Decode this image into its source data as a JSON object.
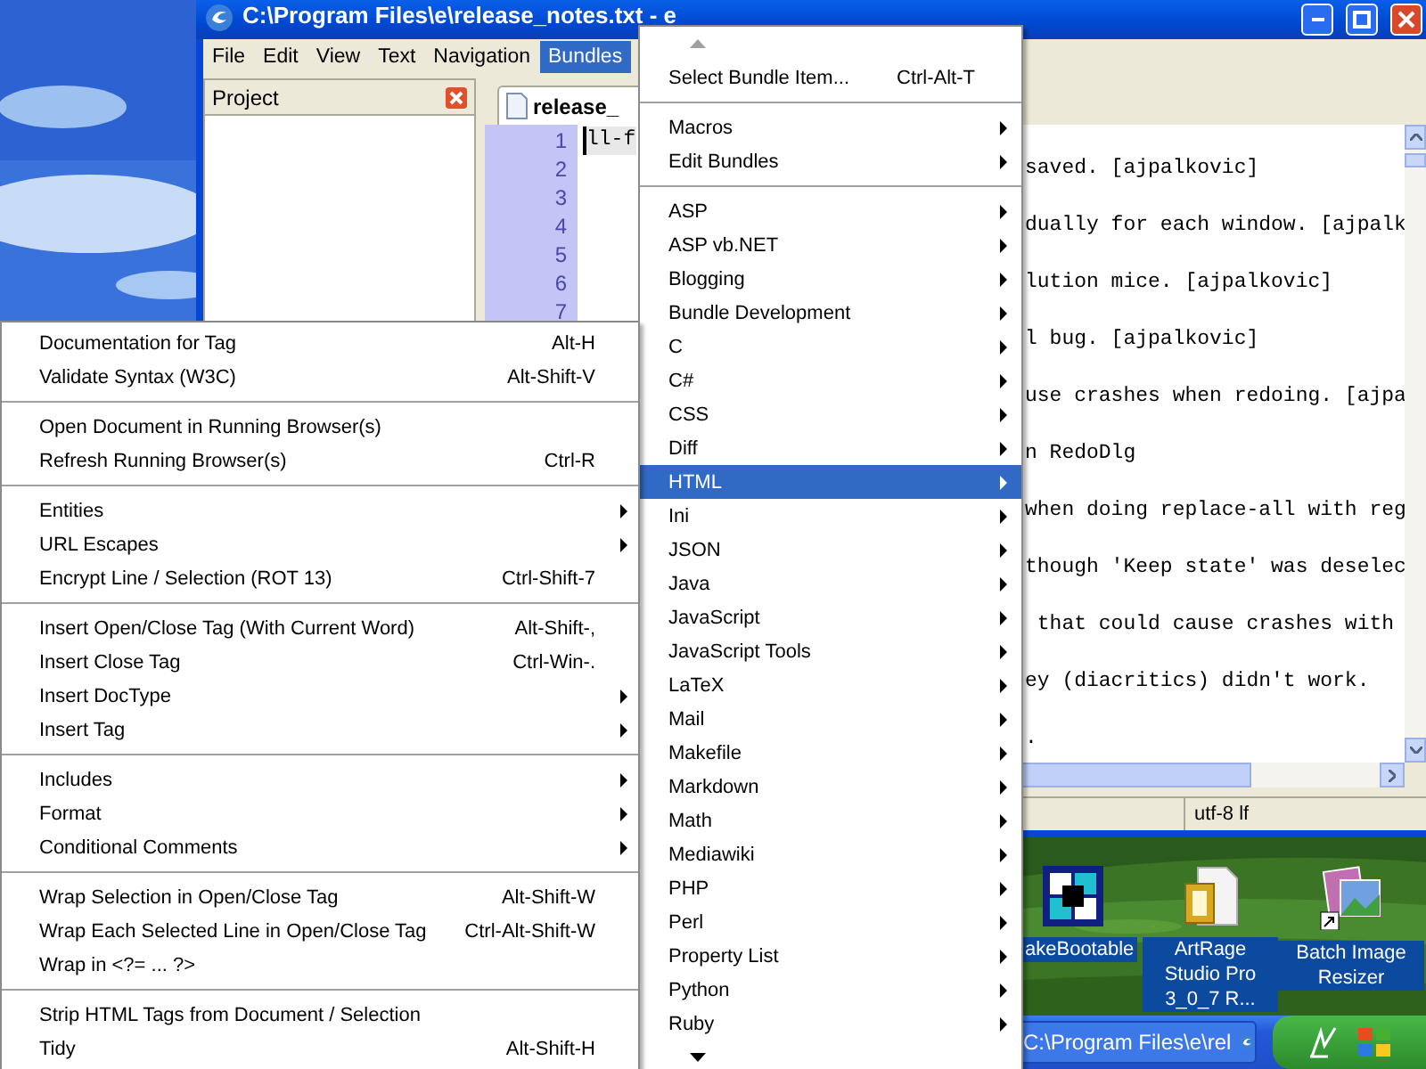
{
  "window": {
    "title": "C:\\Program Files\\e\\release_notes.txt - e"
  },
  "menu_bar": [
    {
      "label": "File",
      "selected": false
    },
    {
      "label": "Edit",
      "selected": false
    },
    {
      "label": "View",
      "selected": false
    },
    {
      "label": "Text",
      "selected": false
    },
    {
      "label": "Navigation",
      "selected": false
    },
    {
      "label": "Bundles",
      "selected": true
    }
  ],
  "project_panel": {
    "title": "Project"
  },
  "tabs": [
    {
      "label": "release_",
      "selected": true
    }
  ],
  "editor": {
    "line_numbers": [
      "1",
      "2",
      "3",
      "4",
      "5",
      "6",
      "7"
    ],
    "lines": [
      {
        "text": "ll-f",
        "current": true
      },
      {
        "text": "saved. [ajpalkovic]",
        "current": false
      },
      {
        "text": "dually for each window. [ajpalk",
        "current": false
      },
      {
        "text": "lution mice. [ajpalkovic]",
        "current": false
      },
      {
        "text": "l bug. [ajpalkovic]",
        "current": false
      },
      {
        "text": "use crashes when redoing. [ajpa",
        "current": false
      },
      {
        "text": "n RedoDlg",
        "current": false
      },
      {
        "text": "when doing replace-all with reg",
        "current": false
      },
      {
        "text": "though 'Keep state' was deselec",
        "current": false
      },
      {
        "text": " that could cause crashes with",
        "current": false
      },
      {
        "text": "ey (diacritics) didn't work.",
        "current": false
      },
      {
        "text": ".",
        "current": false
      }
    ]
  },
  "status_bar": {
    "encoding": "utf-8 lf"
  },
  "bundles_menu": {
    "groups": [
      [
        {
          "label": "Select Bundle Item...",
          "shortcut": "Ctrl-Alt-T",
          "submenu": false,
          "selected": false
        }
      ],
      [
        {
          "label": "Macros",
          "submenu": true,
          "selected": false
        },
        {
          "label": "Edit Bundles",
          "submenu": true,
          "selected": false
        }
      ],
      [
        {
          "label": "ASP",
          "submenu": true,
          "selected": false
        },
        {
          "label": "ASP vb.NET",
          "submenu": true,
          "selected": false
        },
        {
          "label": "Blogging",
          "submenu": true,
          "selected": false
        },
        {
          "label": "Bundle Development",
          "submenu": true,
          "selected": false
        },
        {
          "label": "C",
          "submenu": true,
          "selected": false
        },
        {
          "label": "C#",
          "submenu": true,
          "selected": false
        },
        {
          "label": "CSS",
          "submenu": true,
          "selected": false
        },
        {
          "label": "Diff",
          "submenu": true,
          "selected": false
        },
        {
          "label": "HTML",
          "submenu": true,
          "selected": true
        },
        {
          "label": "Ini",
          "submenu": true,
          "selected": false
        },
        {
          "label": "JSON",
          "submenu": true,
          "selected": false
        },
        {
          "label": "Java",
          "submenu": true,
          "selected": false
        },
        {
          "label": "JavaScript",
          "submenu": true,
          "selected": false
        },
        {
          "label": "JavaScript Tools",
          "submenu": true,
          "selected": false
        },
        {
          "label": "LaTeX",
          "submenu": true,
          "selected": false
        },
        {
          "label": "Mail",
          "submenu": true,
          "selected": false
        },
        {
          "label": "Makefile",
          "submenu": true,
          "selected": false
        },
        {
          "label": "Markdown",
          "submenu": true,
          "selected": false
        },
        {
          "label": "Math",
          "submenu": true,
          "selected": false
        },
        {
          "label": "Mediawiki",
          "submenu": true,
          "selected": false
        },
        {
          "label": "PHP",
          "submenu": true,
          "selected": false
        },
        {
          "label": "Perl",
          "submenu": true,
          "selected": false
        },
        {
          "label": "Property List",
          "submenu": true,
          "selected": false
        },
        {
          "label": "Python",
          "submenu": true,
          "selected": false
        },
        {
          "label": "Ruby",
          "submenu": true,
          "selected": false
        }
      ]
    ]
  },
  "html_submenu": {
    "groups": [
      [
        {
          "label": "Documentation for Tag",
          "shortcut": "Alt-H",
          "submenu": false
        },
        {
          "label": "Validate Syntax (W3C)",
          "shortcut": "Alt-Shift-V",
          "submenu": false
        }
      ],
      [
        {
          "label": "Open Document in Running Browser(s)",
          "submenu": false
        },
        {
          "label": "Refresh Running Browser(s)",
          "shortcut": "Ctrl-R",
          "submenu": false
        }
      ],
      [
        {
          "label": "Entities",
          "submenu": true
        },
        {
          "label": "URL Escapes",
          "submenu": true
        },
        {
          "label": "Encrypt Line / Selection (ROT 13)",
          "shortcut": "Ctrl-Shift-7",
          "submenu": false
        }
      ],
      [
        {
          "label": "Insert Open/Close Tag (With Current Word)",
          "shortcut": "Alt-Shift-,",
          "submenu": false
        },
        {
          "label": "Insert Close Tag",
          "shortcut": "Ctrl-Win-.",
          "submenu": false
        },
        {
          "label": "Insert DocType",
          "submenu": true
        },
        {
          "label": "Insert Tag",
          "submenu": true
        }
      ],
      [
        {
          "label": "Includes",
          "submenu": true
        },
        {
          "label": "Format",
          "submenu": true
        },
        {
          "label": "Conditional Comments",
          "submenu": true
        }
      ],
      [
        {
          "label": "Wrap Selection in Open/Close Tag",
          "shortcut": "Alt-Shift-W",
          "submenu": false
        },
        {
          "label": "Wrap Each Selected Line in Open/Close Tag",
          "shortcut": "Ctrl-Alt-Shift-W",
          "submenu": false
        },
        {
          "label": "Wrap in <?= ... ?>",
          "submenu": false
        }
      ],
      [
        {
          "label": "Strip HTML Tags from Document / Selection",
          "submenu": false
        },
        {
          "label": "Tidy",
          "shortcut": "Alt-Shift-H",
          "submenu": false
        }
      ]
    ]
  },
  "desktop_icons": [
    {
      "label": "akeBootable",
      "kind": "cubes",
      "selected": true
    },
    {
      "label": "ArtRage Studio Pro 3_0_7 R...",
      "kind": "document",
      "selected": true
    },
    {
      "label": "Batch Image Resizer",
      "kind": "photos",
      "selected": true
    }
  ],
  "taskbar": {
    "buttons": [
      {
        "label": "C:\\Program Files\\e\\rel"
      }
    ]
  }
}
